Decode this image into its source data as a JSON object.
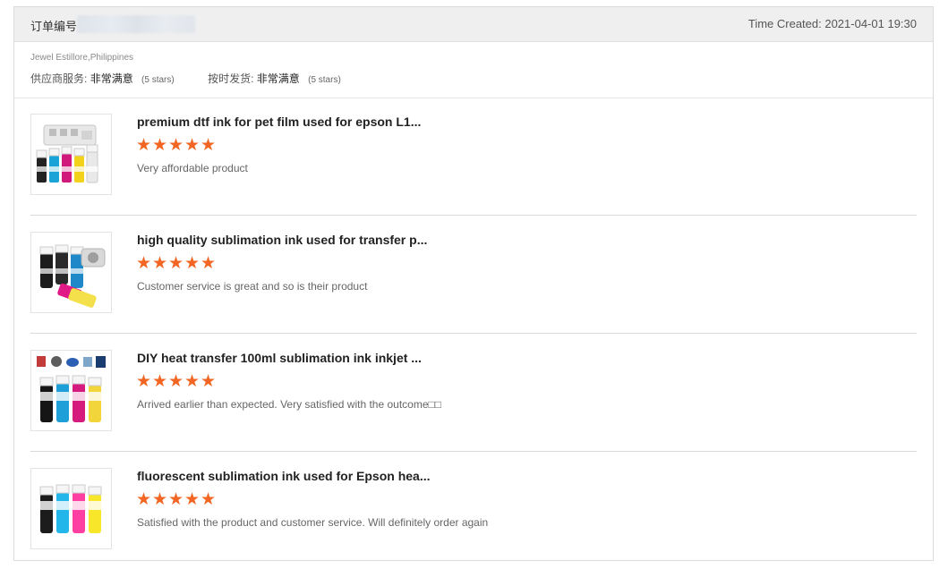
{
  "order": {
    "label": "订单编号",
    "time_created": "Time Created: 2021-04-01 19:30"
  },
  "buyer": "Jewel Estillore,Philippines",
  "ratings": [
    {
      "label": "供应商服务:",
      "value": "非常满意",
      "note": "(5 stars)"
    },
    {
      "label": "按时发货:",
      "value": "非常满意",
      "note": "(5 stars)"
    }
  ],
  "colors": {
    "star": "#f26522",
    "header_bg": "#efefef",
    "divider": "#d9d9d9"
  },
  "items": [
    {
      "title": "premium dtf ink for pet film used for epson L1...",
      "rating": 5,
      "review": "Very affordable product",
      "thumb_icon": "ink-bottles-with-printer-tray-icon"
    },
    {
      "title": "high quality sublimation ink used for transfer p...",
      "rating": 5,
      "review": "Customer service is great and so is their product",
      "thumb_icon": "ink-bottles-with-roll-icon"
    },
    {
      "title": "DIY heat transfer 100ml sublimation ink inkjet ...",
      "rating": 5,
      "review": "Arrived earlier than expected. Very satisfied with the outcome□□",
      "thumb_icon": "ink-bottles-with-products-icon"
    },
    {
      "title": "fluorescent sublimation ink used for Epson hea...",
      "rating": 5,
      "review": "Satisfied with the product and customer service. Will definitely order again",
      "thumb_icon": "fluorescent-ink-bottles-icon"
    }
  ]
}
